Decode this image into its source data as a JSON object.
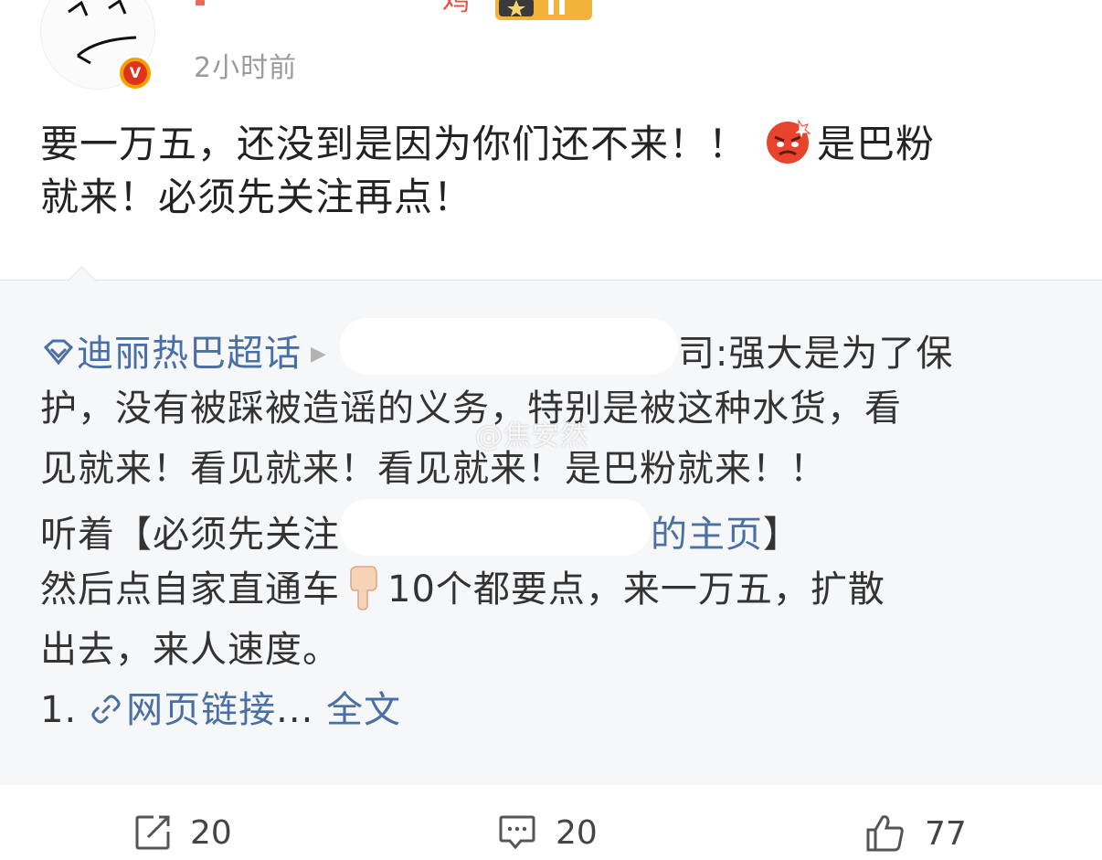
{
  "header": {
    "username_fragment": "鸡",
    "time": "2小时前",
    "verified_mark": "V"
  },
  "post": {
    "line1": "要一万五，还没到是因为你们还不来！！",
    "line1_tail": "是巴粉",
    "line2": "就来！必须先关注再点！"
  },
  "repost": {
    "topic_link": "迪丽热巴超话",
    "row1_after_mask": "司:强大是为了保",
    "row2": "护，没有被踩被造谣的义务，特别是被这种水货，看",
    "row3": "见就来！看见就来！看见就来！是巴粉就来！！",
    "row4_before": "听着【必须先关注",
    "row4_link_tail": "的主页",
    "row4_close": "】",
    "row5_before": "然后点自家直通车",
    "row5_after": "10个都要点，来一万五，扩散",
    "row6": "出去，来人速度。",
    "row7_num": "1.",
    "row7_link": "网页链接",
    "row7_ellipsis": "...",
    "row7_full": "全文",
    "watermark": "@焦安然"
  },
  "actions": {
    "repost_count": "20",
    "comment_count": "20",
    "like_count": "77"
  },
  "colors": {
    "link": "#4a6fa5",
    "card_bg": "#f6f7f9",
    "time": "#9b9b9b",
    "verify": "#f4a100"
  }
}
